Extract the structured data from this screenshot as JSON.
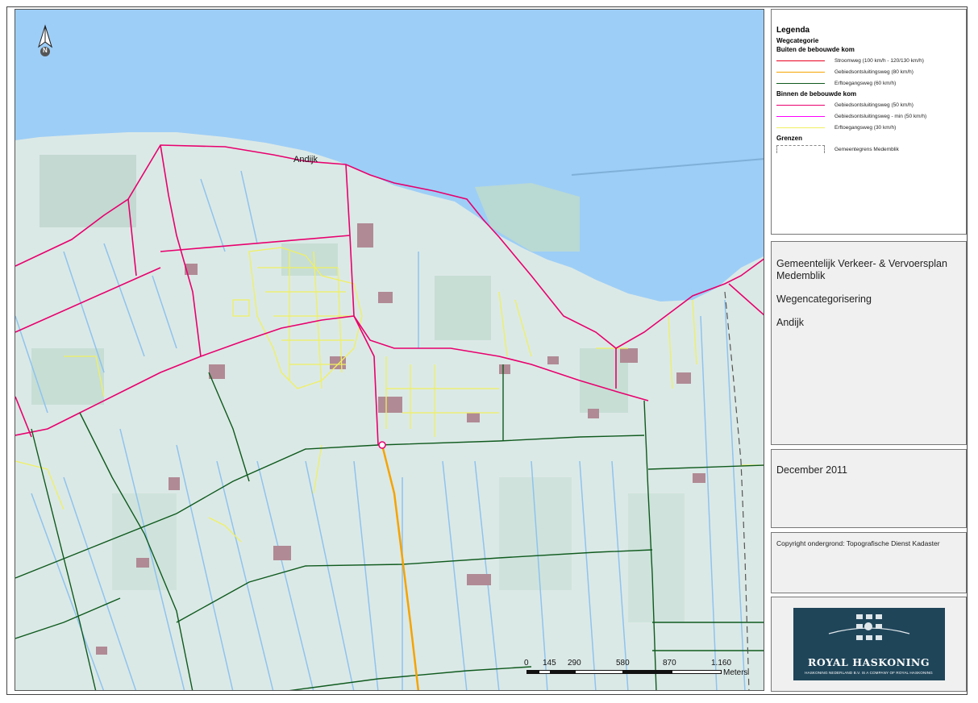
{
  "map": {
    "place_label": "Andijk",
    "north_label": "N",
    "scale": {
      "ticks": [
        "0",
        "145",
        "290",
        "580",
        "870",
        "1.160"
      ],
      "unit": "Meters"
    },
    "colors": {
      "water": "#9dcef7",
      "land": "#d9e8e4",
      "field_dark": "#c7ded5",
      "ditch": "#8fc3ee",
      "building": "#b08a95",
      "stroomweg": "#e8001e",
      "gebiedsontsluitingsweg_80": "#f5a300",
      "erftoegangsweg_60": "#0f5a1e",
      "gebiedsontsluitingsweg_50": "#e8006e",
      "gebiedsontsluitingsweg_min_50": "#ff00ff",
      "erftoegangsweg_30": "#f0f060",
      "gemeentegrens": "#555555"
    }
  },
  "legend": {
    "title": "Legenda",
    "category": "Wegcategorie",
    "outside_heading": "Buiten de bebouwde kom",
    "outside_items": [
      {
        "label": "Stroomweg (100 km/h - 120/130 km/h)",
        "color": "#e8001e"
      },
      {
        "label": "Gebiedsontsluitingsweg (80 km/h)",
        "color": "#f5a300"
      },
      {
        "label": "Erftoegangsweg (60 km/h)",
        "color": "#0f5a1e"
      }
    ],
    "inside_heading": "Binnen de bebouwde kom",
    "inside_items": [
      {
        "label": "Gebiedsontsluitingsweg (50 km/h)",
        "color": "#e8006e"
      },
      {
        "label": "Gebiedsontsluitingsweg - min (50 km/h)",
        "color": "#ff00ff"
      },
      {
        "label": "Erftoegangsweg (30 km/h)",
        "color": "#f0f060"
      }
    ],
    "borders_heading": "Grenzen",
    "border_item": "Gemeentegrens Medemblik"
  },
  "title_block": {
    "line1": "Gemeentelijk Verkeer- & Vervoersplan Medemblik",
    "line2": "Wegencategorisering",
    "line3": "Andijk"
  },
  "date": "December 2011",
  "copyright": "Copyright ondergrond: Topografische Dienst Kadaster",
  "logo": {
    "name": "ROYAL HASKONING",
    "tagline": "HASKONING NEDERLAND B.V. IS A COMPANY OF ROYAL HASKONING",
    "color": "#1f4559"
  }
}
